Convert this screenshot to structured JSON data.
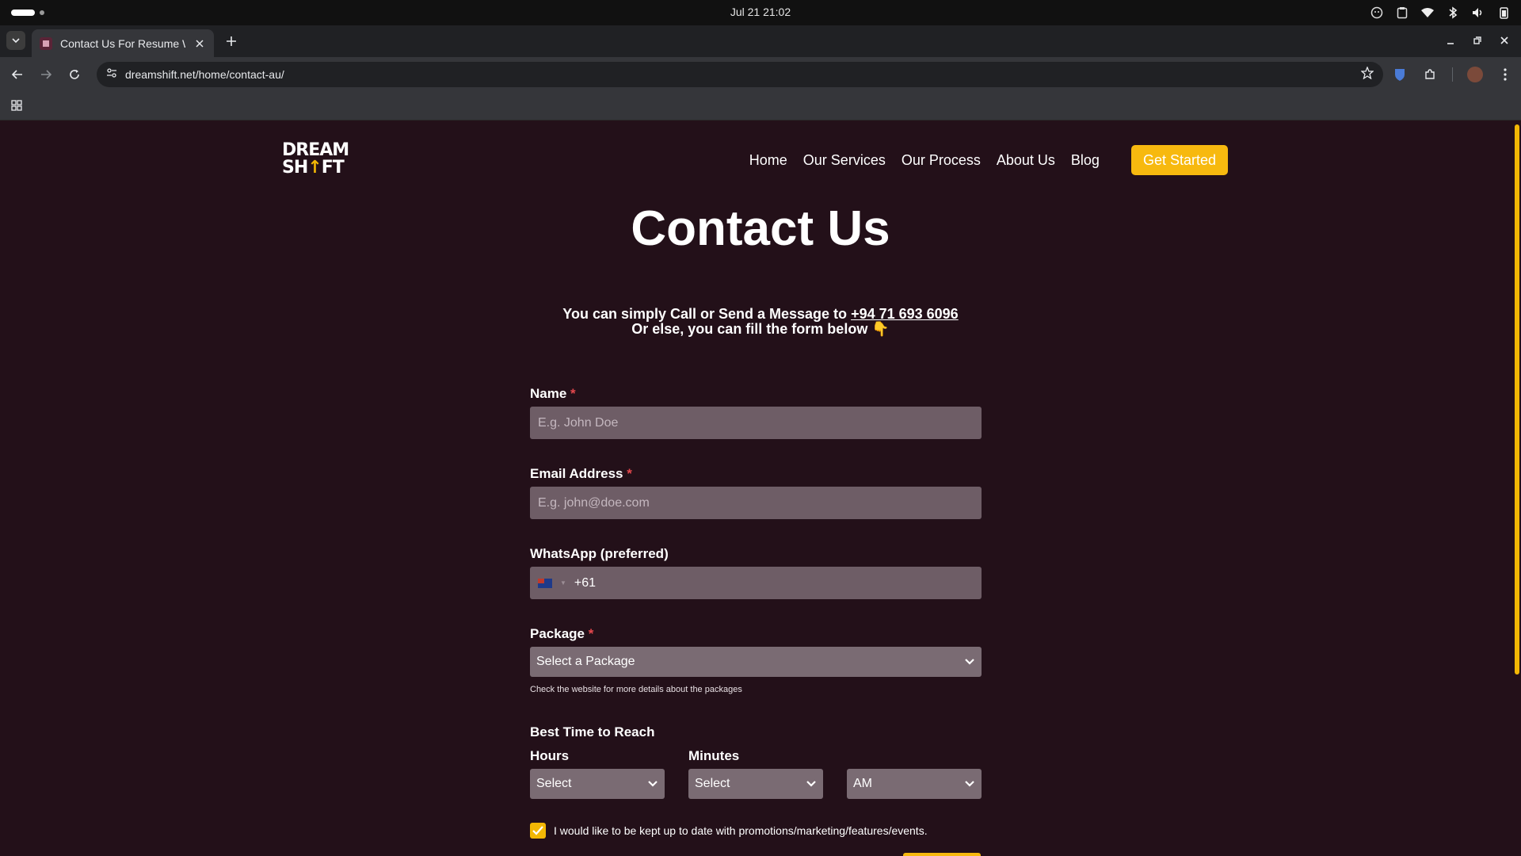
{
  "os": {
    "clock": "Jul 21  21:02"
  },
  "browser": {
    "tab_title": "Contact Us For Resume W",
    "url": "dreamshift.net/home/contact-au/"
  },
  "site": {
    "logo_line1": "DREAM",
    "logo_line2a": "SH",
    "logo_arrow": "↑",
    "logo_line2b": "FT",
    "nav": [
      {
        "label": "Home"
      },
      {
        "label": "Our Services"
      },
      {
        "label": "Our Process"
      },
      {
        "label": "About Us"
      },
      {
        "label": "Blog"
      }
    ],
    "cta_label": "Get Started"
  },
  "page": {
    "title": "Contact Us",
    "intro_line1_prefix": "You can simply Call or Send a Message to ",
    "intro_phone": "+94 71 693 6096",
    "intro_line2": "Or else, you can fill the form below 👇"
  },
  "form": {
    "name_label": "Name",
    "name_placeholder": "E.g. John Doe",
    "required_mark": "*",
    "email_label": "Email Address",
    "email_placeholder": "E.g. john@doe.com",
    "whatsapp_label": "WhatsApp (preferred)",
    "whatsapp_value": "+61",
    "package_label": "Package",
    "package_selected": "Select a Package",
    "package_hint": "Check the website for more details about the packages",
    "time_title": "Best Time to Reach",
    "hours_label": "Hours",
    "hours_selected": "Select",
    "minutes_label": "Minutes",
    "minutes_selected": "Select",
    "ampm_selected": "AM",
    "consent_label": "I would like to be kept up to date with promotions/marketing/features/events.",
    "consent_checked": true
  },
  "colors": {
    "page_bg": "#231019",
    "accent": "#f7b90f",
    "required": "#e5484d",
    "field_bg": "#6e5d66"
  }
}
